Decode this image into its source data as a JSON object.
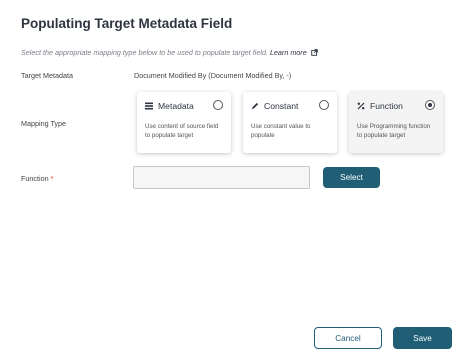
{
  "dialog": {
    "title": "Populating Target Metadata Field",
    "instruction": "Select the appropriate mapping type below to be used to populate target field.",
    "learn_more": "Learn more"
  },
  "target_metadata": {
    "label": "Target Metadata",
    "value": "Document Modified By (Document Modified By, -)"
  },
  "mapping_type": {
    "label": "Mapping Type",
    "options": [
      {
        "title": "Metadata",
        "description": "Use content of source field to populate target",
        "icon": "list-icon",
        "selected": false
      },
      {
        "title": "Constant",
        "description": "Use constant value to populate",
        "icon": "pencil-icon",
        "selected": false
      },
      {
        "title": "Function",
        "description": "Use Programming function to populate target",
        "icon": "percent-function-icon",
        "selected": true
      }
    ]
  },
  "function": {
    "label": "Function",
    "required_marker": "*",
    "value": "",
    "select_button": "Select"
  },
  "footer": {
    "cancel": "Cancel",
    "save": "Save"
  },
  "colors": {
    "primary": "#1f5e75",
    "required": "#d0302f"
  }
}
